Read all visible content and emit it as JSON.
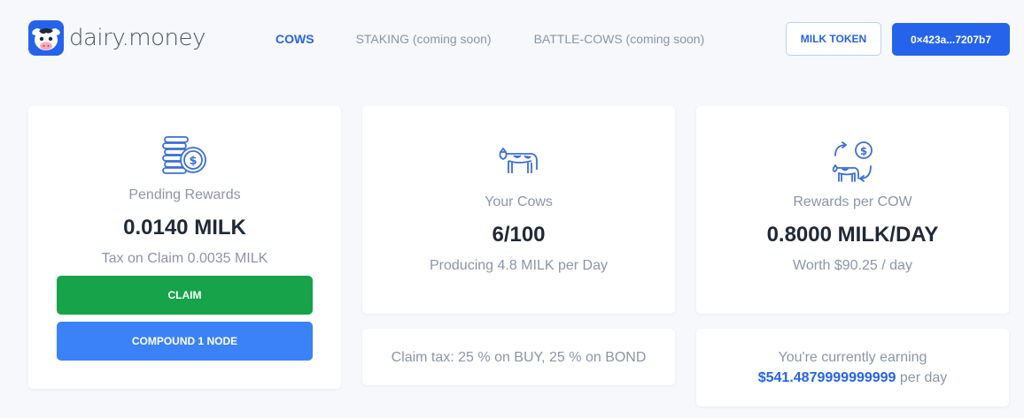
{
  "header": {
    "logo_text": "dairy.money",
    "nav": [
      {
        "label": "COWS",
        "active": true
      },
      {
        "label": "STAKING (coming soon)",
        "active": false
      },
      {
        "label": "BATTLE-COWS (coming soon)",
        "active": false
      }
    ],
    "milk_token_label": "MILK TOKEN",
    "wallet_label": "0×423a...7207b7"
  },
  "pending": {
    "icon": "coins-icon",
    "label": "Pending Rewards",
    "value": "0.0140 MILK",
    "tax": "Tax on Claim 0.0035 MILK",
    "claim_label": "CLAIM",
    "compound_label": "COMPOUND 1 NODE"
  },
  "cows": {
    "icon": "cow-icon",
    "label": "Your Cows",
    "value": "6/100",
    "sub": "Producing 4.8 MILK per Day"
  },
  "rewards": {
    "icon": "cow-exchange-icon",
    "label": "Rewards per COW",
    "value": "0.8000 MILK/DAY",
    "sub": "Worth $90.25 / day"
  },
  "tax_info": {
    "text": "Claim tax: 25 % on BUY, 25 % on BOND"
  },
  "earning": {
    "line1": "You're currently earning",
    "amount": "$541.4879999999999",
    "suffix": " per day"
  },
  "colors": {
    "accent": "#2563eb",
    "claim": "#16a34a",
    "compound": "#3b82f6",
    "muted": "#8b95a7"
  }
}
